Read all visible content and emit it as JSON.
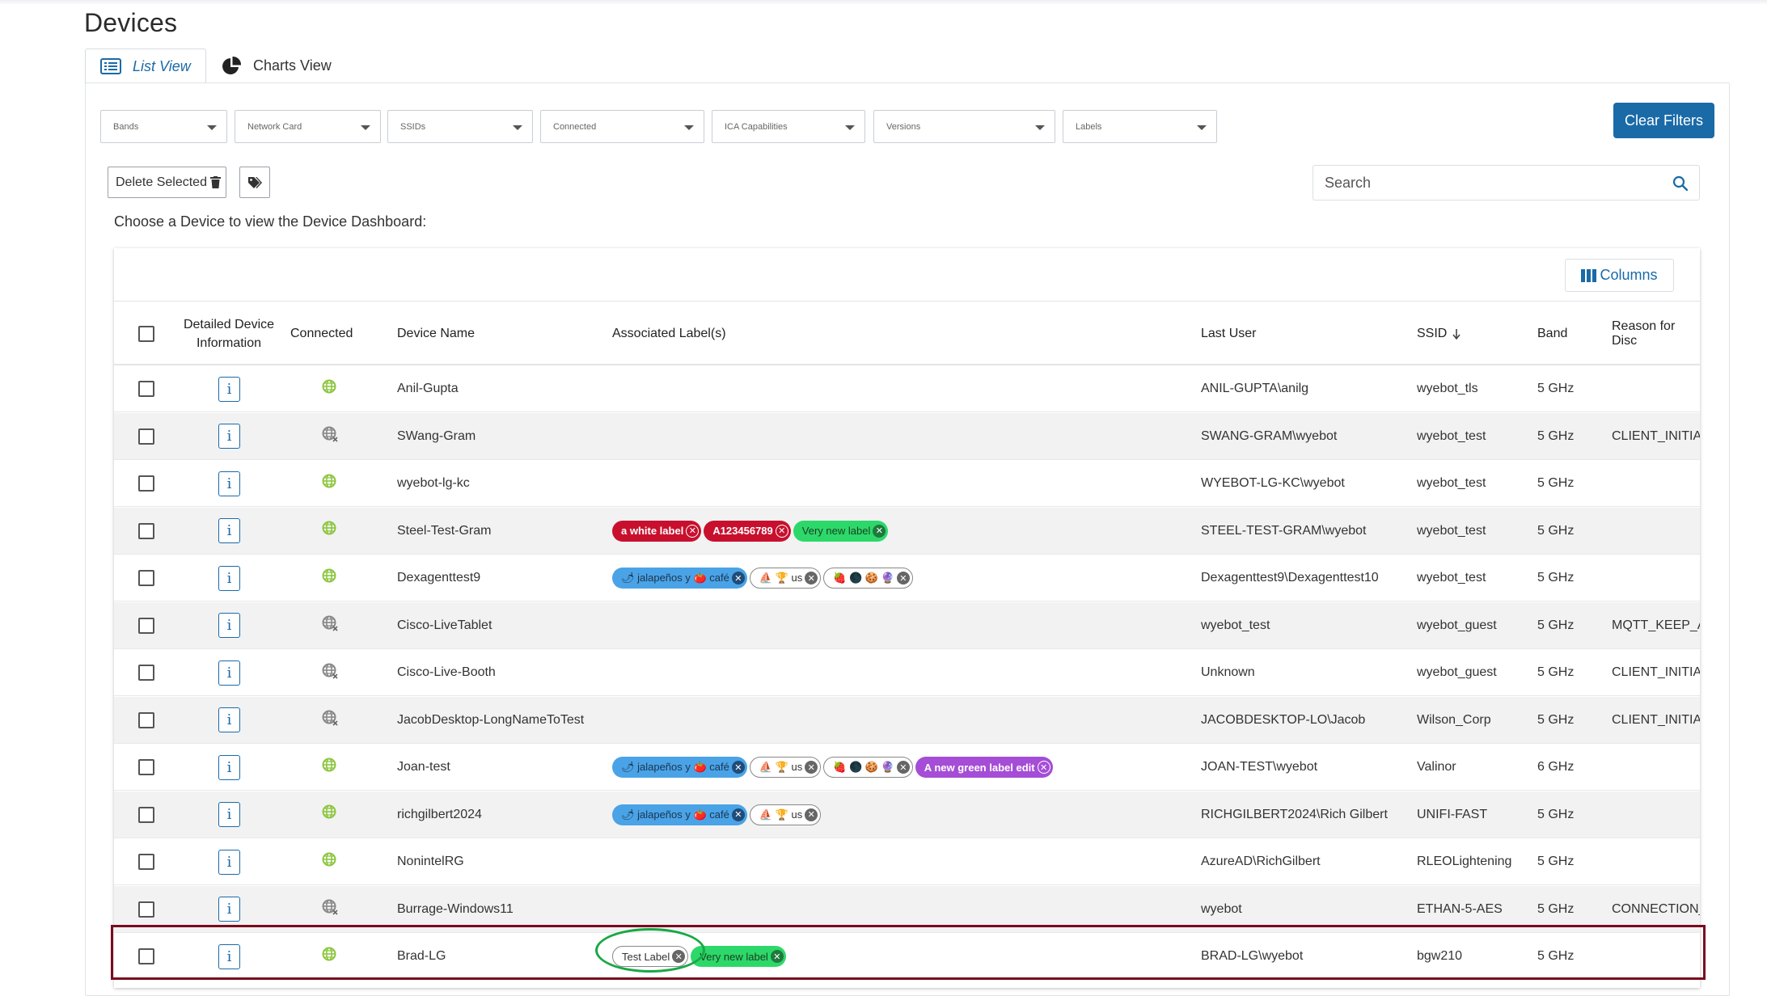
{
  "page": {
    "title": "Devices"
  },
  "tabs": [
    {
      "label": "List View",
      "icon": "list-icon"
    },
    {
      "label": "Charts View",
      "icon": "pie-chart-icon"
    }
  ],
  "filters": [
    "Bands",
    "Network Card",
    "SSIDs",
    "Connected",
    "ICA Capabilities",
    "Versions",
    "Labels"
  ],
  "actions": {
    "clear_filters": "Clear Filters",
    "delete_selected": "Delete Selected",
    "columns": "Columns"
  },
  "search": {
    "placeholder": "Search"
  },
  "instruction": "Choose a Device to view the Device Dashboard:",
  "table": {
    "headers": {
      "detail": "Detailed Device Information",
      "connected": "Connected",
      "device_name": "Device Name",
      "labels": "Associated Label(s)",
      "last_user": "Last User",
      "ssid": "SSID",
      "band": "Band",
      "reason": "Reason for Disc"
    },
    "ssid_sort": "descending",
    "rows": [
      {
        "connected": true,
        "name": "Anil-Gupta",
        "labels": [],
        "last_user": "ANIL-GUPTA\\anilg",
        "ssid": "wyebot_tls",
        "band": "5 GHz",
        "reason": ""
      },
      {
        "connected": false,
        "name": "SWang-Gram",
        "labels": [],
        "last_user": "SWANG-GRAM\\wyebot",
        "ssid": "wyebot_test",
        "band": "5 GHz",
        "reason": "CLIENT_INITIAT"
      },
      {
        "connected": true,
        "name": "wyebot-lg-kc",
        "labels": [],
        "last_user": "WYEBOT-LG-KC\\wyebot",
        "ssid": "wyebot_test",
        "band": "5 GHz",
        "reason": ""
      },
      {
        "connected": true,
        "name": "Steel-Test-Gram",
        "labels": [
          {
            "text": "a white label",
            "style": "red"
          },
          {
            "text": "A123456789",
            "style": "red"
          },
          {
            "text": "Very new label",
            "style": "green"
          }
        ],
        "last_user": "STEEL-TEST-GRAM\\wyebot",
        "ssid": "wyebot_test",
        "band": "5 GHz",
        "reason": ""
      },
      {
        "connected": true,
        "name": "Dexagenttest9",
        "labels": [
          {
            "text": "🌶 jalapeños y 🍅 café",
            "style": "blue"
          },
          {
            "text": "⛵ 🏆 us",
            "style": "white"
          },
          {
            "text": "🍓 🌑 🍪 🔮",
            "style": "white"
          }
        ],
        "last_user": "Dexagenttest9\\Dexagenttest10",
        "ssid": "wyebot_test",
        "band": "5 GHz",
        "reason": ""
      },
      {
        "connected": false,
        "name": "Cisco-LiveTablet",
        "labels": [],
        "last_user": "wyebot_test",
        "ssid": "wyebot_guest",
        "band": "5 GHz",
        "reason": "MQTT_KEEP_AI"
      },
      {
        "connected": false,
        "name": "Cisco-Live-Booth",
        "labels": [],
        "last_user": "Unknown",
        "ssid": "wyebot_guest",
        "band": "5 GHz",
        "reason": "CLIENT_INITIAT"
      },
      {
        "connected": false,
        "name": "JacobDesktop-LongNameToTest",
        "labels": [],
        "last_user": "JACOBDESKTOP-LO\\Jacob",
        "ssid": "Wilson_Corp",
        "band": "5 GHz",
        "reason": "CLIENT_INITIAT"
      },
      {
        "connected": true,
        "name": "Joan-test",
        "labels": [
          {
            "text": "🌶 jalapeños y 🍅 café",
            "style": "blue"
          },
          {
            "text": "⛵ 🏆 us",
            "style": "white"
          },
          {
            "text": "🍓 🌑 🍪 🔮",
            "style": "white"
          },
          {
            "text": "A new green label edit",
            "style": "purple"
          }
        ],
        "last_user": "JOAN-TEST\\wyebot",
        "ssid": "Valinor",
        "band": "6 GHz",
        "reason": ""
      },
      {
        "connected": true,
        "name": "richgilbert2024",
        "labels": [
          {
            "text": "🌶 jalapeños y 🍅 café",
            "style": "blue"
          },
          {
            "text": "⛵ 🏆 us",
            "style": "white"
          }
        ],
        "last_user": "RICHGILBERT2024\\Rich Gilbert",
        "ssid": "UNIFI-FAST",
        "band": "5 GHz",
        "reason": ""
      },
      {
        "connected": true,
        "name": "NonintelRG",
        "labels": [],
        "last_user": "AzureAD\\RichGilbert",
        "ssid": "RLEOLightening",
        "band": "5 GHz",
        "reason": ""
      },
      {
        "connected": false,
        "name": "Burrage-Windows11",
        "labels": [],
        "last_user": "wyebot",
        "ssid": "ETHAN-5-AES",
        "band": "5 GHz",
        "reason": "CONNECTION_I"
      },
      {
        "connected": true,
        "name": "Brad-LG",
        "labels": [
          {
            "text": "Test Label",
            "style": "white"
          },
          {
            "text": "Very new label",
            "style": "green"
          }
        ],
        "last_user": "BRAD-LG\\wyebot",
        "ssid": "bgw210",
        "band": "5 GHz",
        "reason": ""
      }
    ]
  },
  "colors": {
    "accent": "#1a6aa8",
    "connected": "#8cc63f",
    "highlight_box": "#7a0b1e",
    "highlight_circle": "#18a844"
  }
}
